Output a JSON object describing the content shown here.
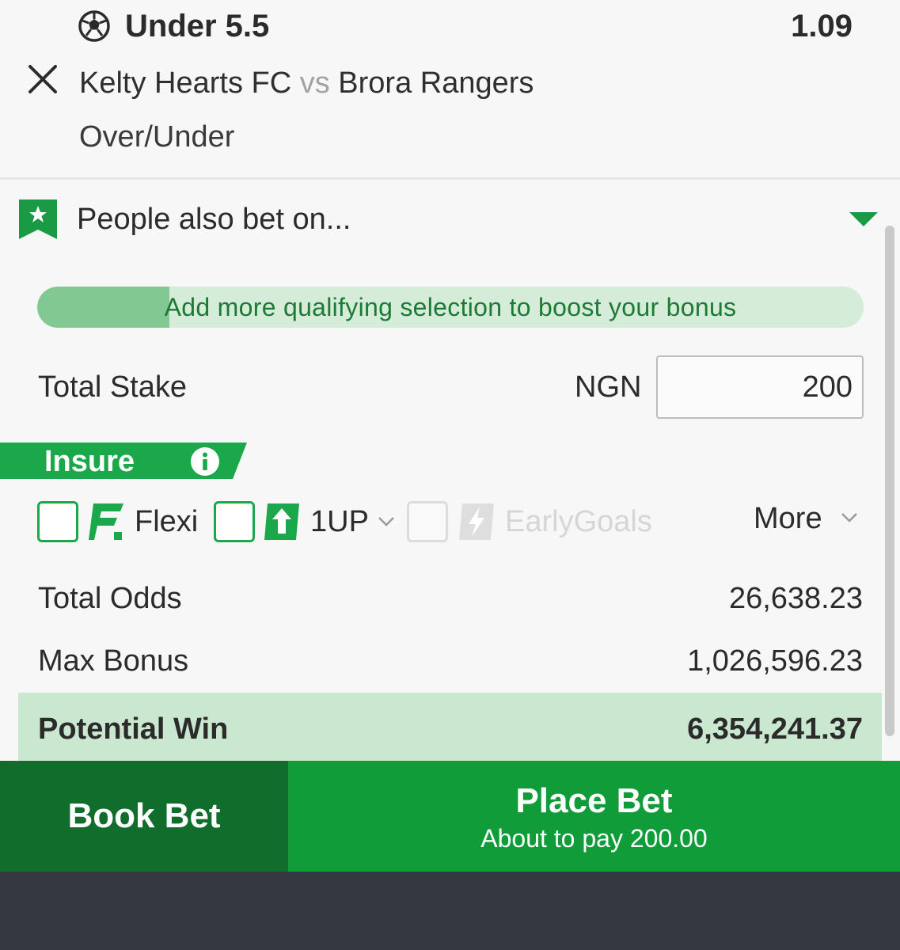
{
  "selection": {
    "pick": "Under 5.5",
    "odds": "1.09",
    "home_team": "Kelty Hearts FC",
    "vs": "vs",
    "away_team": "Brora Rangers",
    "market": "Over/Under"
  },
  "people_also_bet": {
    "title": "People also bet on..."
  },
  "bonus": {
    "message": "Add more qualifying selection to boost your bonus",
    "progress": 0.16
  },
  "stake": {
    "label": "Total Stake",
    "currency": "NGN",
    "value": "200"
  },
  "insure": {
    "label": "Insure",
    "options": [
      {
        "label": "Flexi",
        "enabled": true
      },
      {
        "label": "1UP",
        "enabled": true
      },
      {
        "label": "EarlyGoals",
        "enabled": false
      }
    ],
    "more_label": "More"
  },
  "totals": {
    "total_odds_label": "Total Odds",
    "total_odds_value": "26,638.23",
    "max_bonus_label": "Max Bonus",
    "max_bonus_value": "1,026,596.23",
    "potential_win_label": "Potential Win",
    "potential_win_value": "6,354,241.37"
  },
  "actions": {
    "book_bet": "Book Bet",
    "place_bet": "Place Bet",
    "place_bet_sub": "About to pay 200.00"
  },
  "colors": {
    "primary_green": "#119c3a",
    "dark_green": "#116d2c",
    "check_green": "#1aa84a",
    "highlight_green": "#c9e8cf"
  }
}
